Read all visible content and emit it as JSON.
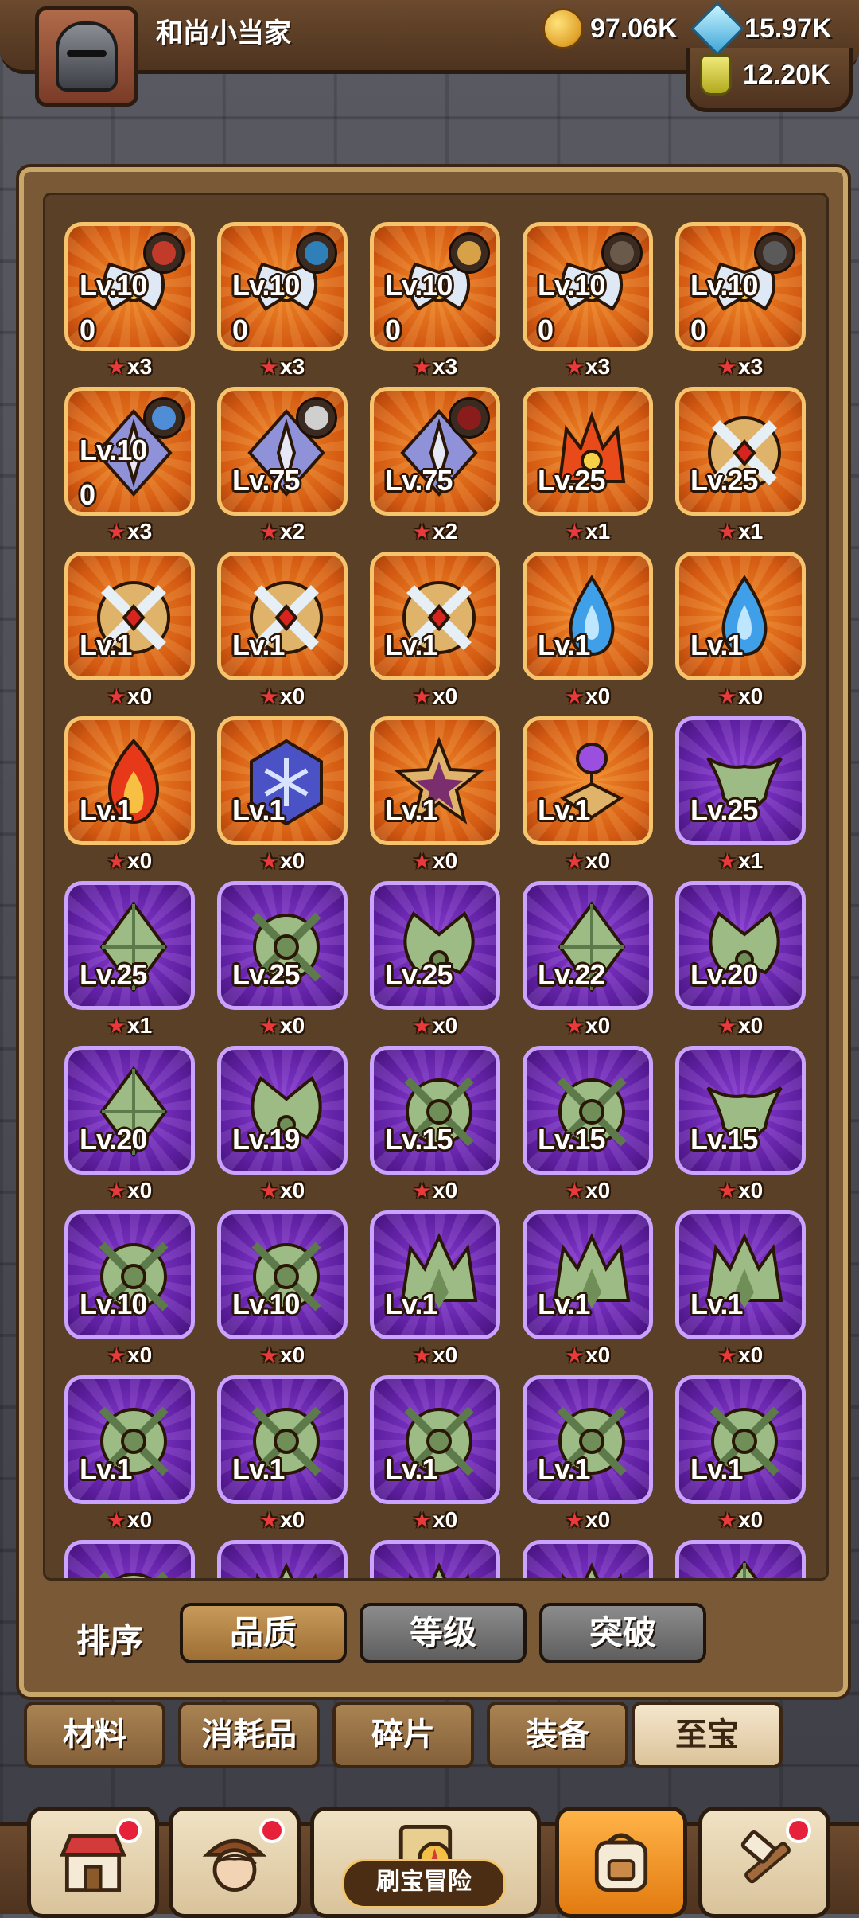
{
  "header": {
    "username": "和尚小当家",
    "gold": "97.06K",
    "diamonds": "15.97K",
    "potions": "12.20K",
    "icons": [
      "helmet-avatar-icon",
      "gold-coin-icon",
      "diamond-icon",
      "potion-icon"
    ]
  },
  "colors": {
    "orange_card": "#d45a12",
    "purple_card": "#5e1fa0",
    "panel": "#7a5a36",
    "star": "#e83a3a"
  },
  "items": [
    {
      "level": "Lv.10",
      "sub": "0",
      "count": "x3",
      "rarity": "orange",
      "icon": "winged-crest-icon",
      "owner": true
    },
    {
      "level": "Lv.10",
      "sub": "0",
      "count": "x3",
      "rarity": "orange",
      "icon": "winged-crest-icon",
      "owner": true
    },
    {
      "level": "Lv.10",
      "sub": "0",
      "count": "x3",
      "rarity": "orange",
      "icon": "winged-crest-icon",
      "owner": true
    },
    {
      "level": "Lv.10",
      "sub": "0",
      "count": "x3",
      "rarity": "orange",
      "icon": "winged-crest-icon",
      "owner": true
    },
    {
      "level": "Lv.10",
      "sub": "0",
      "count": "x3",
      "rarity": "orange",
      "icon": "winged-crest-icon",
      "owner": true
    },
    {
      "level": "Lv.10",
      "sub": "0",
      "count": "x3",
      "rarity": "orange",
      "icon": "diamond-shield-icon",
      "owner": true
    },
    {
      "level": "Lv.75",
      "sub": "",
      "count": "x2",
      "rarity": "orange",
      "icon": "diamond-shield-icon",
      "owner": true
    },
    {
      "level": "Lv.75",
      "sub": "",
      "count": "x2",
      "rarity": "orange",
      "icon": "diamond-shield-icon",
      "owner": true
    },
    {
      "level": "Lv.25",
      "sub": "",
      "count": "x1",
      "rarity": "orange",
      "icon": "flame-crown-icon",
      "owner": false
    },
    {
      "level": "Lv.25",
      "sub": "",
      "count": "x1",
      "rarity": "orange",
      "icon": "cross-shield-icon",
      "owner": false
    },
    {
      "level": "Lv.1",
      "sub": "",
      "count": "x0",
      "rarity": "orange",
      "icon": "cross-shield-icon",
      "owner": false
    },
    {
      "level": "Lv.1",
      "sub": "",
      "count": "x0",
      "rarity": "orange",
      "icon": "cross-shield-icon",
      "owner": false
    },
    {
      "level": "Lv.1",
      "sub": "",
      "count": "x0",
      "rarity": "orange",
      "icon": "cross-shield-icon",
      "owner": false
    },
    {
      "level": "Lv.1",
      "sub": "",
      "count": "x0",
      "rarity": "orange",
      "icon": "water-drop-icon",
      "owner": false
    },
    {
      "level": "Lv.1",
      "sub": "",
      "count": "x0",
      "rarity": "orange",
      "icon": "water-drop-icon",
      "owner": false
    },
    {
      "level": "Lv.1",
      "sub": "",
      "count": "x0",
      "rarity": "orange",
      "icon": "fire-icon",
      "owner": false
    },
    {
      "level": "Lv.1",
      "sub": "",
      "count": "x0",
      "rarity": "orange",
      "icon": "snowflake-hexagon-icon",
      "owner": false
    },
    {
      "level": "Lv.1",
      "sub": "",
      "count": "x0",
      "rarity": "orange",
      "icon": "star-badge-icon",
      "owner": false
    },
    {
      "level": "Lv.1",
      "sub": "",
      "count": "x0",
      "rarity": "orange",
      "icon": "orb-pedestal-icon",
      "owner": false
    },
    {
      "level": "Lv.25",
      "sub": "",
      "count": "x1",
      "rarity": "purple",
      "icon": "horned-helm-icon",
      "owner": false
    },
    {
      "level": "Lv.25",
      "sub": "",
      "count": "x1",
      "rarity": "purple",
      "icon": "crystal-shard-icon",
      "owner": false
    },
    {
      "level": "Lv.25",
      "sub": "",
      "count": "x0",
      "rarity": "purple",
      "icon": "leaf-emblem-icon",
      "owner": false
    },
    {
      "level": "Lv.25",
      "sub": "",
      "count": "x0",
      "rarity": "purple",
      "icon": "wing-emblem-icon",
      "owner": false
    },
    {
      "level": "Lv.22",
      "sub": "",
      "count": "x0",
      "rarity": "purple",
      "icon": "crystal-shard-icon",
      "owner": false
    },
    {
      "level": "Lv.20",
      "sub": "",
      "count": "x0",
      "rarity": "purple",
      "icon": "wing-emblem-icon",
      "owner": false
    },
    {
      "level": "Lv.20",
      "sub": "",
      "count": "x0",
      "rarity": "purple",
      "icon": "crystal-shard-icon",
      "owner": false
    },
    {
      "level": "Lv.19",
      "sub": "",
      "count": "x0",
      "rarity": "purple",
      "icon": "wing-emblem-icon",
      "owner": false
    },
    {
      "level": "Lv.15",
      "sub": "",
      "count": "x0",
      "rarity": "purple",
      "icon": "leaf-emblem-icon",
      "owner": false
    },
    {
      "level": "Lv.15",
      "sub": "",
      "count": "x0",
      "rarity": "purple",
      "icon": "leaf-emblem-icon",
      "owner": false
    },
    {
      "level": "Lv.15",
      "sub": "",
      "count": "x0",
      "rarity": "purple",
      "icon": "horned-helm-icon",
      "owner": false
    },
    {
      "level": "Lv.10",
      "sub": "",
      "count": "x0",
      "rarity": "purple",
      "icon": "leaf-emblem-icon",
      "owner": false
    },
    {
      "level": "Lv.10",
      "sub": "",
      "count": "x0",
      "rarity": "purple",
      "icon": "leaf-emblem-icon",
      "owner": false
    },
    {
      "level": "Lv.1",
      "sub": "",
      "count": "x0",
      "rarity": "purple",
      "icon": "spiky-crown-icon",
      "owner": false
    },
    {
      "level": "Lv.1",
      "sub": "",
      "count": "x0",
      "rarity": "purple",
      "icon": "spiky-crown-icon",
      "owner": false
    },
    {
      "level": "Lv.1",
      "sub": "",
      "count": "x0",
      "rarity": "purple",
      "icon": "spiky-crown-icon",
      "owner": false
    },
    {
      "level": "Lv.1",
      "sub": "",
      "count": "x0",
      "rarity": "purple",
      "icon": "leaf-emblem-icon",
      "owner": false
    },
    {
      "level": "Lv.1",
      "sub": "",
      "count": "x0",
      "rarity": "purple",
      "icon": "leaf-emblem-icon",
      "owner": false
    },
    {
      "level": "Lv.1",
      "sub": "",
      "count": "x0",
      "rarity": "purple",
      "icon": "leaf-emblem-icon",
      "owner": false
    },
    {
      "level": "Lv.1",
      "sub": "",
      "count": "x0",
      "rarity": "purple",
      "icon": "leaf-emblem-icon",
      "owner": false
    },
    {
      "level": "Lv.1",
      "sub": "",
      "count": "x0",
      "rarity": "purple",
      "icon": "leaf-emblem-icon",
      "owner": false
    },
    {
      "level": "",
      "sub": "",
      "count": "",
      "rarity": "purple",
      "icon": "leaf-emblem-icon",
      "owner": false
    },
    {
      "level": "",
      "sub": "",
      "count": "",
      "rarity": "purple",
      "icon": "spiky-crown-icon",
      "owner": false
    },
    {
      "level": "",
      "sub": "",
      "count": "",
      "rarity": "purple",
      "icon": "spiky-crown-icon",
      "owner": false
    },
    {
      "level": "",
      "sub": "",
      "count": "",
      "rarity": "purple",
      "icon": "spiky-crown-icon",
      "owner": false
    },
    {
      "level": "",
      "sub": "",
      "count": "",
      "rarity": "purple",
      "icon": "crystal-shard-icon",
      "owner": false
    }
  ],
  "sort": {
    "label": "排序",
    "options": [
      {
        "label": "品质",
        "active": true
      },
      {
        "label": "等级",
        "active": false
      },
      {
        "label": "突破",
        "active": false
      }
    ]
  },
  "tabs": [
    {
      "label": "材料",
      "active": false
    },
    {
      "label": "消耗品",
      "active": false
    },
    {
      "label": "碎片",
      "active": false
    },
    {
      "label": "装备",
      "active": false
    },
    {
      "label": "至宝",
      "active": true
    }
  ],
  "bottom_nav": {
    "adventure_label": "刷宝冒险",
    "items": [
      {
        "icon": "shop-icon",
        "badge": true
      },
      {
        "icon": "hero-icon",
        "badge": true
      },
      {
        "icon": "treasure-map-icon",
        "badge": false
      },
      {
        "icon": "backpack-icon",
        "badge": false,
        "active": true
      },
      {
        "icon": "forge-hammer-icon",
        "badge": true
      }
    ]
  }
}
